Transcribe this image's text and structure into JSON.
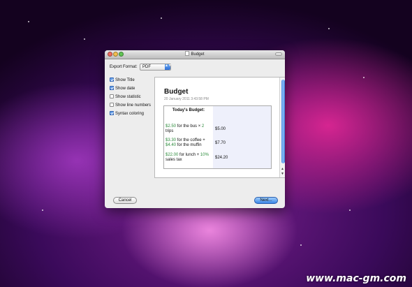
{
  "window": {
    "title": "Budget"
  },
  "export": {
    "label": "Export Format:",
    "value": "PDF",
    "arrows": "▲▼"
  },
  "options": [
    {
      "label": "Show Title",
      "checked": true
    },
    {
      "label": "Show date",
      "checked": true
    },
    {
      "label": "Show statistic",
      "checked": false
    },
    {
      "label": "Show line numbers",
      "checked": false
    },
    {
      "label": "Syntax coloring",
      "checked": true
    }
  ],
  "preview": {
    "title": "Budget",
    "date": "20 January 2011 3:43:58 PM",
    "table_header": "Today's Budget:",
    "items": [
      {
        "amount": "$2.50",
        "text": " for the bus × ",
        "mult": "2",
        "rest": " trips",
        "result": "$5.00"
      },
      {
        "amount": "$3.30",
        "text": " for the coffee + ",
        "amount2": "$4.40",
        "rest": " for the muffin",
        "result": "$7.70"
      },
      {
        "amount": "$22.00",
        "text": " for lunch + ",
        "pct": "10%",
        "rest": " sales tax",
        "result": "$24.20"
      }
    ],
    "scroll_up": "▲",
    "scroll_down": "▼"
  },
  "buttons": {
    "cancel": "Cancel",
    "next": "Next..."
  },
  "watermark": "www.mac-gm.com",
  "colors": {
    "accent": "#3a86e6",
    "number_green": "#2a8a3a"
  }
}
